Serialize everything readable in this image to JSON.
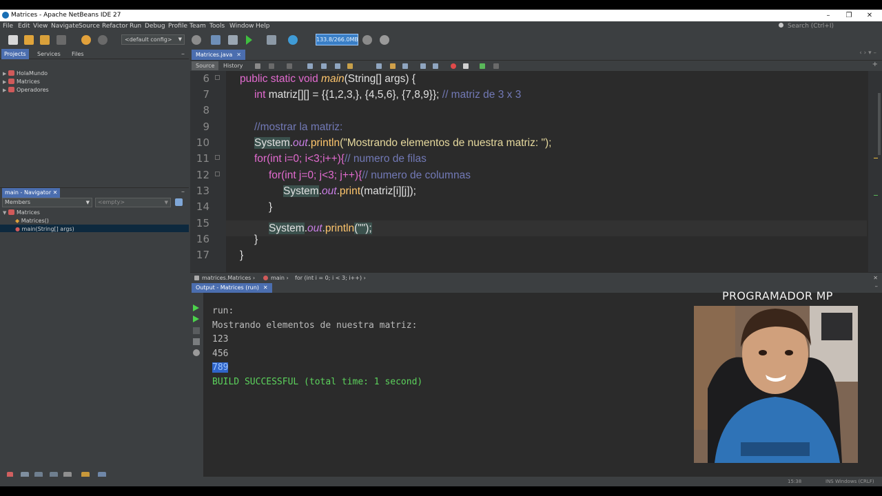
{
  "window": {
    "title": "Matrices - Apache NetBeans IDE 27"
  },
  "menu": [
    "File",
    "Edit",
    "View",
    "Navigate",
    "Source",
    "Refactor",
    "Run",
    "Debug",
    "Profile",
    "Team",
    "Tools",
    "Window",
    "Help"
  ],
  "search": {
    "placeholder": "Search (Ctrl+I)"
  },
  "toolbar": {
    "config": "<default config>",
    "memory": "133.8/266.0MB"
  },
  "projects_panel": {
    "tabs": [
      "Projects",
      "Services",
      "Files"
    ],
    "items": [
      "HolaMundo",
      "Matrices",
      "Operadores"
    ]
  },
  "navigator": {
    "title": "main - Navigator",
    "filter": "Members",
    "empty": "<empty>",
    "root": "Matrices",
    "items": [
      "Matrices()",
      "main(String[] args)"
    ]
  },
  "editor": {
    "file_tab": "Matrices.java",
    "modes": [
      "Source",
      "History"
    ],
    "line_numbers": [
      "6",
      "7",
      "8",
      "9",
      "10",
      "11",
      "12",
      "13",
      "14",
      "15",
      "16",
      "17"
    ],
    "code": {
      "l6_a": "public static void ",
      "l6_fn": "main",
      "l6_b": "(String[] args) {",
      "l7_kw": "int ",
      "l7_b": "matriz[][] = {{1,2,3,}, {4,5,6}, {7,8,9}}; ",
      "l7_cmt": "// matriz de 3 x 3",
      "l9_cmt": "//mostrar la matriz:",
      "l10_cls": "System",
      "l10_field": "out",
      "l10_meth": "println",
      "l10_str": "(\"Mostrando elementos de nuestra matriz: \");",
      "l11_a": "for(int i=0; i<3;i++){",
      "l11_cmt": "// numero de filas",
      "l12_a": "for(int j=0; j<3; j++){",
      "l12_cmt": "// numero de columnas",
      "l13_cls": "System",
      "l13_field": "out",
      "l13_meth": "print",
      "l13_rest": "(matriz[i][j]);",
      "l14": "}",
      "l15_cls": "System",
      "l15_field": "out",
      "l15_meth": "println",
      "l15_rest": "(\"\");",
      "l16": "}",
      "l17": "}"
    },
    "breadcrumbs": [
      "matrices.Matrices",
      "main",
      "for (int i = 0; i < 3; i++)"
    ]
  },
  "output": {
    "tab": "Output - Matrices (run)",
    "lines": [
      "run:",
      "Mostrando elementos de nuestra matriz:",
      "123",
      "456",
      "789",
      "BUILD SUCCESSFUL (total time: 1 second)"
    ]
  },
  "status": {
    "position": "15:38",
    "mode": "INS Windows (CRLF)"
  },
  "overlay": {
    "channel": "PROGRAMADOR MP"
  },
  "colors": {
    "accent": "#4b6eaf",
    "background": "#2b2b2b",
    "panel": "#3c3f41",
    "success": "#5cd25c",
    "keyword": "#e36bd0"
  }
}
